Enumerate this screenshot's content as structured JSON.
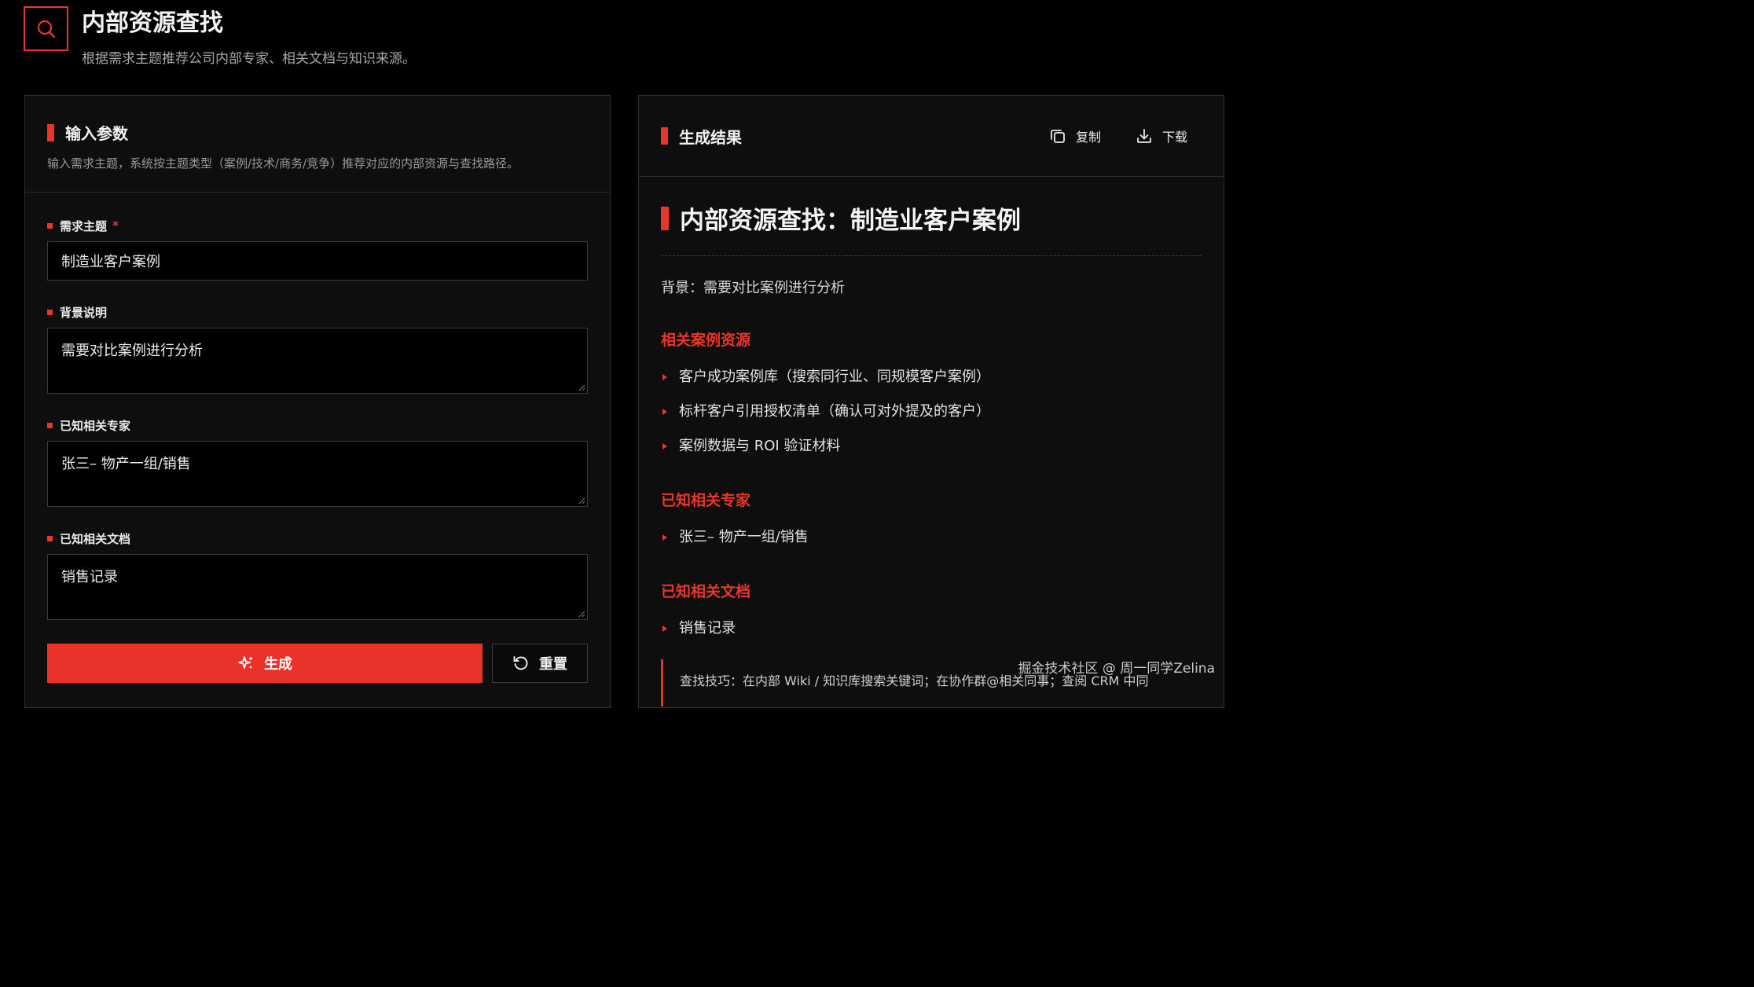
{
  "header": {
    "title": "内部资源查找",
    "subtitle": "根据需求主题推荐公司内部专家、相关文档与知识来源。"
  },
  "input_panel": {
    "title": "输入参数",
    "description": "输入需求主题，系统按主题类型（案例/技术/商务/竞争）推荐对应的内部资源与查找路径。",
    "fields": [
      {
        "label": "需求主题",
        "required_mark": "*",
        "value": "制造业客户案例"
      },
      {
        "label": "背景说明",
        "value": "需要对比案例进行分析"
      },
      {
        "label": "已知相关专家",
        "value": "张三– 物产一组/销售"
      },
      {
        "label": "已知相关文档",
        "value": "销售记录"
      }
    ],
    "generate_label": "生成",
    "reset_label": "重置"
  },
  "result_panel": {
    "title": "生成结果",
    "copy_label": "复制",
    "download_label": "下载",
    "doc_title": "内部资源查找：制造业客户案例",
    "background": "背景：需要对比案例进行分析",
    "sections": [
      {
        "heading": "相关案例资源",
        "items": [
          "客户成功案例库（搜索同行业、同规模客户案例）",
          "标杆客户引用授权清单（确认可对外提及的客户）",
          "案例数据与 ROI 验证材料"
        ]
      },
      {
        "heading": "已知相关专家",
        "items": [
          "张三– 物产一组/销售"
        ]
      },
      {
        "heading": "已知相关文档",
        "items": [
          "销售记录"
        ]
      }
    ],
    "tip": "查找技巧：在内部 Wiki / 知识库搜索关键词；在协作群@相关同事；查阅 CRM 中同"
  },
  "watermark": "掘金技术社区 @ 周一同学Zelina",
  "colors": {
    "accent": "#e8372a",
    "background": "#000000",
    "panel": "#0e0e0e"
  },
  "icons": [
    "search-icon",
    "sparkle-icon",
    "reset-icon",
    "copy-icon",
    "download-icon"
  ]
}
